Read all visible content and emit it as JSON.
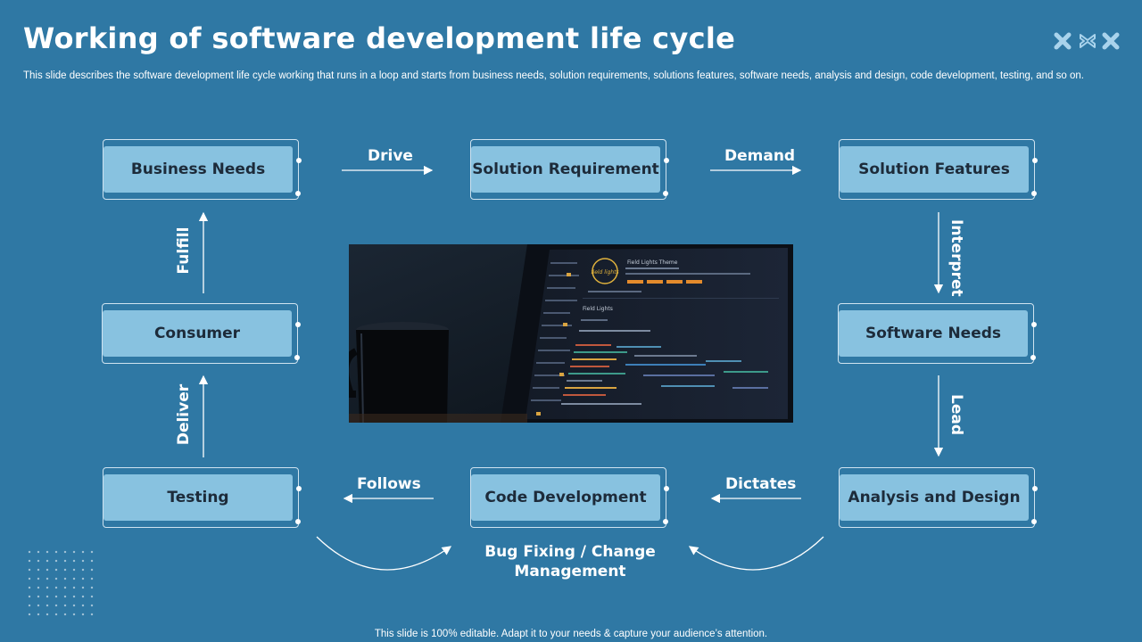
{
  "header": {
    "title": "Working of software development life cycle",
    "subtitle": "This slide describes the software development life cycle working that runs in a loop and starts from business needs, solution requirements, solutions features, software needs, analysis and design, code development, testing, and so on."
  },
  "nodes": {
    "business_needs": "Business Needs",
    "solution_requirement": "Solution Requirement",
    "solution_features": "Solution Features",
    "software_needs": "Software Needs",
    "analysis_and_design": "Analysis and Design",
    "code_development": "Code Development",
    "testing": "Testing",
    "consumer": "Consumer"
  },
  "edges": {
    "drive": "Drive",
    "demand": "Demand",
    "interpret": "Interpret",
    "lead": "Lead",
    "dictates": "Dictates",
    "follows": "Follows",
    "deliver": "Deliver",
    "fulfill": "Fulfill"
  },
  "bottom_loop_label": "Bug Fixing / Change Management",
  "footer": "This slide is 100% editable. Adapt it to your needs & capture your audience’s attention.",
  "photo": {
    "screen_title": "Field Lights Theme",
    "badge_text": "field lights",
    "section_heading": "Field Lights"
  },
  "icons": {
    "header_decoration": "cross-pattern-icon",
    "photo": "laptop-code-editor-photo"
  },
  "colors": {
    "background": "#2f78a4",
    "node_fill": "#88c2e0",
    "node_text": "#1d2b3a",
    "text": "#ffffff",
    "decoration": "#a9d3ec"
  }
}
